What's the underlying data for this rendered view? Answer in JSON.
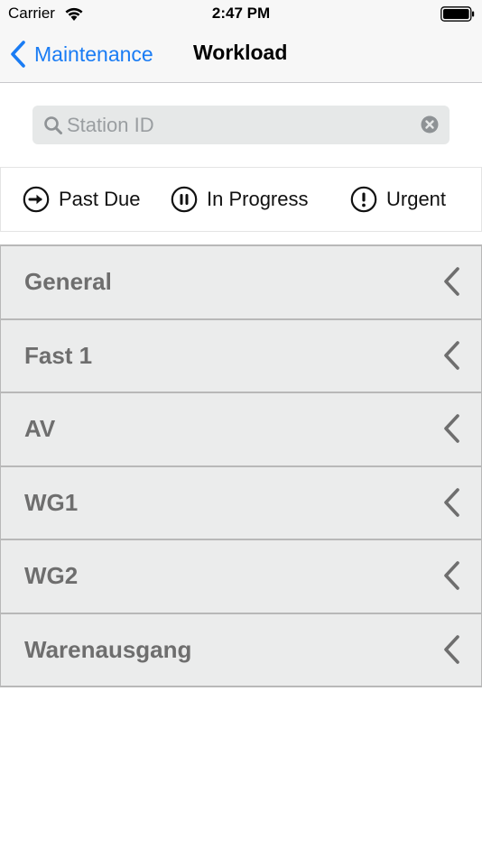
{
  "status_bar": {
    "carrier": "Carrier",
    "time": "2:47 PM"
  },
  "nav": {
    "back_label": "Maintenance",
    "title": "Workload"
  },
  "search": {
    "placeholder": "Station ID",
    "value": ""
  },
  "filters": [
    {
      "label": "Past Due",
      "icon": "arrow-right-circle-icon"
    },
    {
      "label": "In Progress",
      "icon": "pause-circle-icon"
    },
    {
      "label": "Urgent",
      "icon": "exclamation-circle-icon"
    }
  ],
  "stations": [
    {
      "label": "General"
    },
    {
      "label": "Fast 1"
    },
    {
      "label": "AV"
    },
    {
      "label": "WG1"
    },
    {
      "label": "WG2"
    },
    {
      "label": "Warenausgang"
    }
  ],
  "colors": {
    "accent": "#1a7cf4",
    "row_background": "#ebecec",
    "row_text": "#6e6e6e",
    "search_background": "#e6e8e8"
  }
}
